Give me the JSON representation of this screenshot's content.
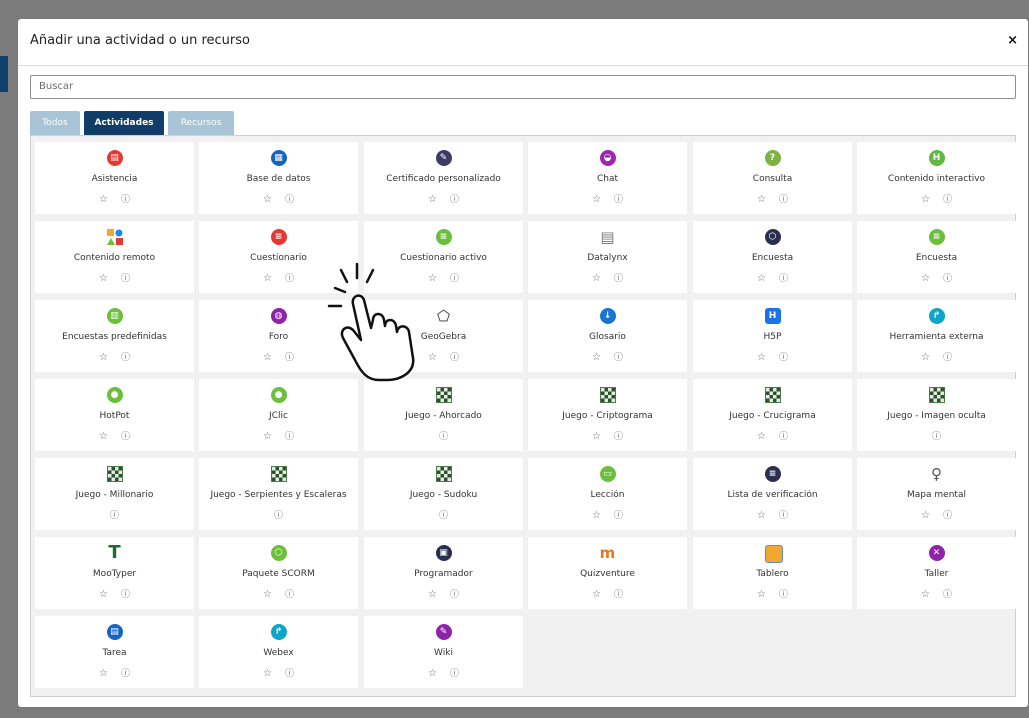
{
  "modal": {
    "title": "Añadir una actividad o un recurso",
    "close_label": "×"
  },
  "search": {
    "placeholder": "Buscar"
  },
  "tabs": [
    {
      "label": "Todos",
      "active": false
    },
    {
      "label": "Actividades",
      "active": true
    },
    {
      "label": "Recursos",
      "active": false
    }
  ],
  "tiles": [
    {
      "name": "Asistencia",
      "icon": "attendance-icon",
      "color": "#e53935",
      "star": true
    },
    {
      "name": "Base de datos",
      "icon": "database-icon",
      "color": "#1565c0",
      "star": true
    },
    {
      "name": "Certificado personalizado",
      "icon": "certificate-icon",
      "color": "#3e3a66",
      "star": true
    },
    {
      "name": "Chat",
      "icon": "chat-icon",
      "color": "#9c27b0",
      "star": true
    },
    {
      "name": "Consulta",
      "icon": "question-icon",
      "color": "#7cb342",
      "star": true
    },
    {
      "name": "Contenido interactivo",
      "icon": "h5p-icon",
      "color": "#5fb840",
      "star": true
    },
    {
      "name": "Contenido remoto",
      "icon": "shapes-icon",
      "color": "#4caf50",
      "star": true
    },
    {
      "name": "Cuestionario",
      "icon": "quiz-icon",
      "color": "#e53935",
      "star": true
    },
    {
      "name": "Cuestionario activo",
      "icon": "list-icon",
      "color": "#6cbf3a",
      "star": true
    },
    {
      "name": "Datalynx",
      "icon": "datalynx-icon",
      "color": "#777777",
      "star": true
    },
    {
      "name": "Encuesta",
      "icon": "cube-icon",
      "color": "#2b2f4f",
      "star": true
    },
    {
      "name": "Encuesta",
      "icon": "feedback-icon",
      "color": "#6cbf3a",
      "star": true
    },
    {
      "name": "Encuestas predefinidas",
      "icon": "chart-icon",
      "color": "#6cbf3a",
      "star": true
    },
    {
      "name": "Foro",
      "icon": "forum-icon",
      "color": "#8e24aa",
      "star": true
    },
    {
      "name": "GeoGebra",
      "icon": "geogebra-icon",
      "color": "#333333",
      "star": true
    },
    {
      "name": "Glosario",
      "icon": "glossary-icon",
      "color": "#1976d2",
      "star": true
    },
    {
      "name": "H5P",
      "icon": "h5p-square-icon",
      "color": "#1a73e8",
      "star": true
    },
    {
      "name": "Herramienta externa",
      "icon": "external-tool-icon",
      "color": "#0ea5c6",
      "star": true
    },
    {
      "name": "HotPot",
      "icon": "hotpot-icon",
      "color": "#6cbf3a",
      "star": true
    },
    {
      "name": "JClic",
      "icon": "jclic-icon",
      "color": "#6cbf3a",
      "star": true
    },
    {
      "name": "Juego - Ahorcado",
      "icon": "game-board-icon",
      "color": "#2f4f2f",
      "star": false
    },
    {
      "name": "Juego - Criptograma",
      "icon": "game-board-icon",
      "color": "#2f4f2f",
      "star": true
    },
    {
      "name": "Juego - Crucigrama",
      "icon": "game-board-icon",
      "color": "#2f4f2f",
      "star": true
    },
    {
      "name": "Juego - Imagen oculta",
      "icon": "game-board-icon",
      "color": "#2f4f2f",
      "star": false
    },
    {
      "name": "Juego - Millonario",
      "icon": "game-board-icon",
      "color": "#2f4f2f",
      "star": false
    },
    {
      "name": "Juego - Serpientes y Escaleras",
      "icon": "game-board-icon",
      "color": "#2f4f2f",
      "star": false
    },
    {
      "name": "Juego - Sudoku",
      "icon": "game-board-icon",
      "color": "#2f4f2f",
      "star": false
    },
    {
      "name": "Lección",
      "icon": "lesson-icon",
      "color": "#6cbf3a",
      "star": true
    },
    {
      "name": "Lista de verificación",
      "icon": "checklist-icon",
      "color": "#2b2f4f",
      "star": true
    },
    {
      "name": "Mapa mental",
      "icon": "lightbulb-icon",
      "color": "#555555",
      "star": true
    },
    {
      "name": "MooTyper",
      "icon": "mootyper-icon",
      "color": "#1e6b2e",
      "star": true
    },
    {
      "name": "Paquete SCORM",
      "icon": "scorm-icon",
      "color": "#6cbf3a",
      "star": true
    },
    {
      "name": "Programador",
      "icon": "calendar-icon",
      "color": "#2b2f4f",
      "star": true
    },
    {
      "name": "Quizventure",
      "icon": "quizventure-icon",
      "color": "#e07a1f",
      "star": true
    },
    {
      "name": "Tablero",
      "icon": "board-icon",
      "color": "#f0a830",
      "star": true
    },
    {
      "name": "Taller",
      "icon": "tools-icon",
      "color": "#8e24aa",
      "star": true
    },
    {
      "name": "Tarea",
      "icon": "assignment-icon",
      "color": "#1565c0",
      "star": true
    },
    {
      "name": "Webex",
      "icon": "webex-icon",
      "color": "#0ea5c6",
      "star": true
    },
    {
      "name": "Wiki",
      "icon": "wiki-icon",
      "color": "#8e24aa",
      "star": true
    }
  ],
  "glyphs": {
    "star": "☆",
    "info": "ⓘ"
  }
}
